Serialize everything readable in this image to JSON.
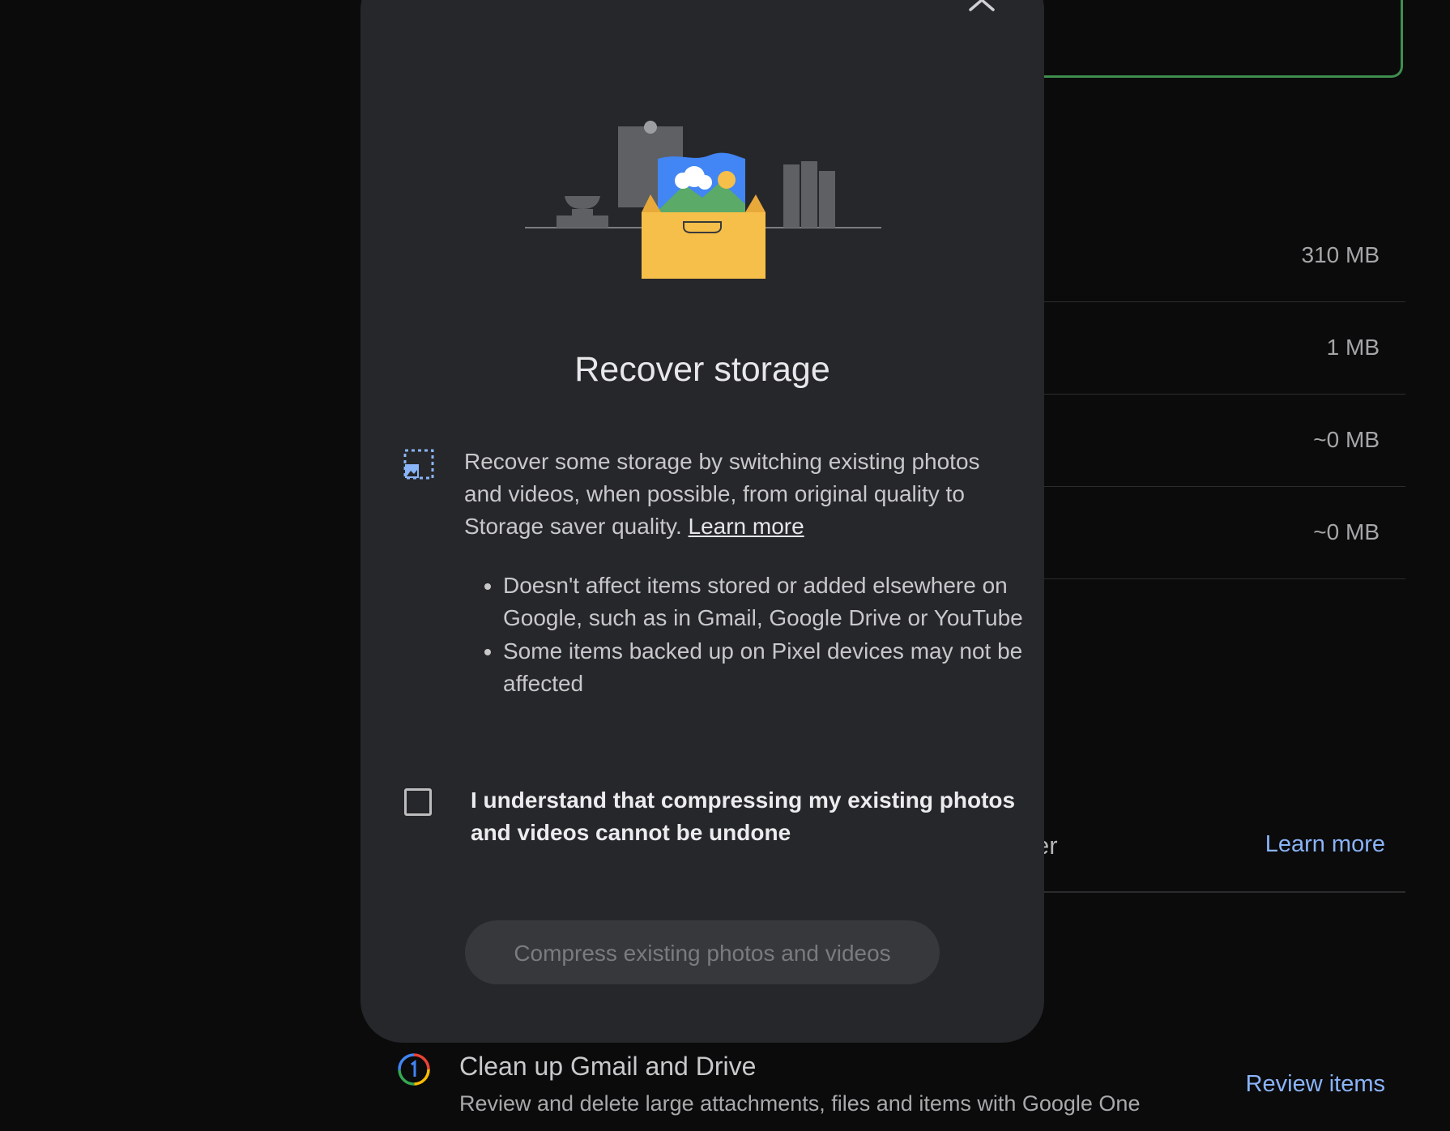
{
  "background": {
    "storage_rows": [
      {
        "size": "310 MB"
      },
      {
        "size": "1 MB"
      },
      {
        "size": "~0 MB"
      },
      {
        "size": "~0 MB"
      }
    ],
    "partial_text": "er",
    "learn_more": "Learn more",
    "cleanup": {
      "title": "Clean up Gmail and Drive",
      "subtitle": "Review and delete large attachments, files and items with Google One",
      "button": "Review items"
    }
  },
  "dialog": {
    "title": "Recover storage",
    "description": "Recover some storage by switching existing photos and videos, when possible, from original quality to Storage saver quality.",
    "learn_more": "Learn more",
    "bullets": [
      "Doesn't affect items stored or added elsewhere on Google, such as in Gmail, Google Drive or YouTube",
      "Some items backed up on Pixel devices may not be affected"
    ],
    "checkbox_label": "I understand that compressing my existing photos and videos cannot be undone",
    "checkbox_checked": false,
    "primary_button": "Compress existing photos and videos",
    "primary_button_enabled": false
  },
  "colors": {
    "dialog_bg": "#26272a",
    "link_blue": "#8ab4f8",
    "accent_green": "#3f8f4f",
    "box_yellow": "#f6bf4a"
  },
  "icons": [
    "close-icon",
    "storage-saver-icon",
    "google-one-icon"
  ]
}
